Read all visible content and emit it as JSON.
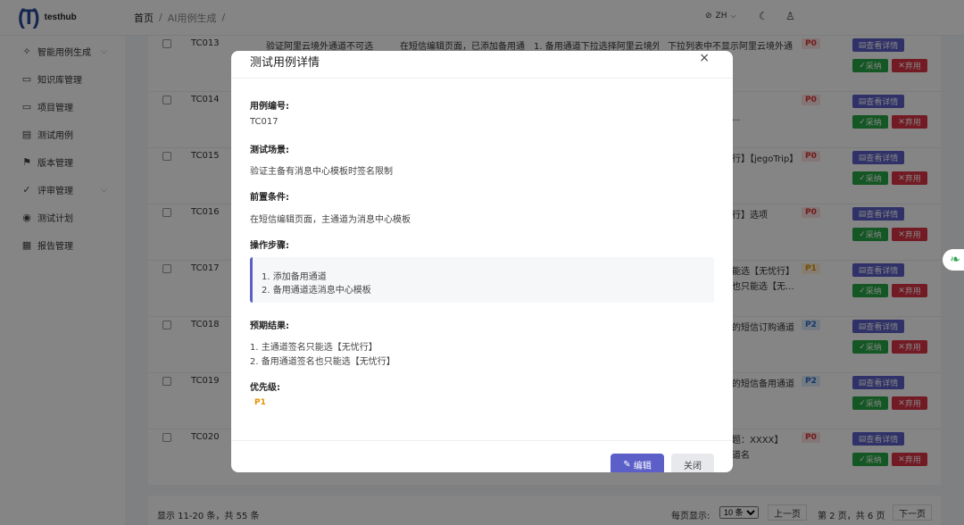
{
  "app": {
    "logo_mark": "(T)",
    "logo_text": "testhub"
  },
  "breadcrumb": [
    "首页",
    "/",
    "AI用例生成",
    "/"
  ],
  "topbar": {
    "lang": "ZH",
    "lang_icon": "globe-icon",
    "moon_icon": "moon-icon",
    "user_icon": "user-icon"
  },
  "sidebar": {
    "items": [
      {
        "label": "智能用例生成",
        "icon": "✧",
        "chevron": "⌵"
      },
      {
        "label": "知识库管理",
        "icon": "▭",
        "chevron": ""
      },
      {
        "label": "项目管理",
        "icon": "▭",
        "chevron": ""
      },
      {
        "label": "测试用例",
        "icon": "▤",
        "chevron": ""
      },
      {
        "label": "版本管理",
        "icon": "⚑",
        "chevron": ""
      },
      {
        "label": "评审管理",
        "icon": "✓",
        "chevron": "⌵"
      },
      {
        "label": "测试计划",
        "icon": "◉",
        "chevron": ""
      },
      {
        "label": "报告管理",
        "icon": "▦",
        "chevron": ""
      }
    ]
  },
  "table": {
    "view_label": "查看详情",
    "adopt_label": "采纳",
    "discard_label": "弃用",
    "rows": [
      {
        "id": "TC013",
        "c1": "验证阿里云境外通道不可选",
        "c2": "在短信编辑页面，已添加备用通",
        "c3": "1. 备用通道下拉选择阿里云境外",
        "c4": "下拉列表中不显示阿里云境外通",
        "priority": "P0",
        "pclass": "p0"
      },
      {
        "id": "TC014",
        "c1": "",
        "c2": "",
        "c3": "",
        "c4": "",
        "priority": "P0",
        "pclass": "p0"
      },
      {
        "id": "TC015",
        "c1": "",
        "c2": "",
        "c3": "",
        "c4": "",
        "priority": "P0",
        "pclass": "p0"
      },
      {
        "id": "TC016",
        "c1": "",
        "c2": "",
        "c3": "",
        "c4": "",
        "priority": "P0",
        "pclass": "p0"
      },
      {
        "id": "TC017",
        "c1": "",
        "c2": "",
        "c3": "",
        "c4": "",
        "priority": "P1",
        "pclass": "p1"
      },
      {
        "id": "TC018",
        "c1": "",
        "c2": "",
        "c3": "",
        "c4": "",
        "priority": "P2",
        "pclass": "p2"
      },
      {
        "id": "TC019",
        "c1": "",
        "c2": "",
        "c3": "",
        "c4": "",
        "priority": "P2",
        "pclass": "p2"
      },
      {
        "id": "TC020",
        "c1": "",
        "c2": "",
        "c3": "",
        "c4": "",
        "priority": "P0",
        "pclass": "p0"
      }
    ],
    "behind_fragments": [
      "...",
      "行】【jegoTrip】",
      "行】选项",
      "能选【无忧行】",
      "也只能选【无...",
      "的短信订购通道",
      "的短信备用通道",
      "题：XXXX】",
      "道名"
    ]
  },
  "pager": {
    "info": "显示 11-20 条，共 55 条",
    "per_page_label": "每页显示:",
    "per_page_value": "10 条",
    "prev": "上一页",
    "page_text": "第 2 页，共 6 页",
    "next": "下一页"
  },
  "modal": {
    "title": "测试用例详情",
    "close_icon": "×",
    "fields": {
      "id_label": "用例编号:",
      "id_value": "TC017",
      "scene_label": "测试场景:",
      "scene_value": "验证主备有消息中心模板时签名限制",
      "pre_label": "前置条件:",
      "pre_value": "在短信编辑页面，主通道为消息中心模板",
      "steps_label": "操作步骤:",
      "steps": [
        "1. 添加备用通道",
        "2. 备用通道选消息中心模板"
      ],
      "expect_label": "预期结果:",
      "expect": [
        "1. 主通道签名只能选【无忧行】",
        "2. 备用通道签名也只能选【无忧行】"
      ],
      "priority_label": "优先级:",
      "priority_value": "P1"
    },
    "edit_label": "编辑",
    "close_label": "关闭"
  }
}
